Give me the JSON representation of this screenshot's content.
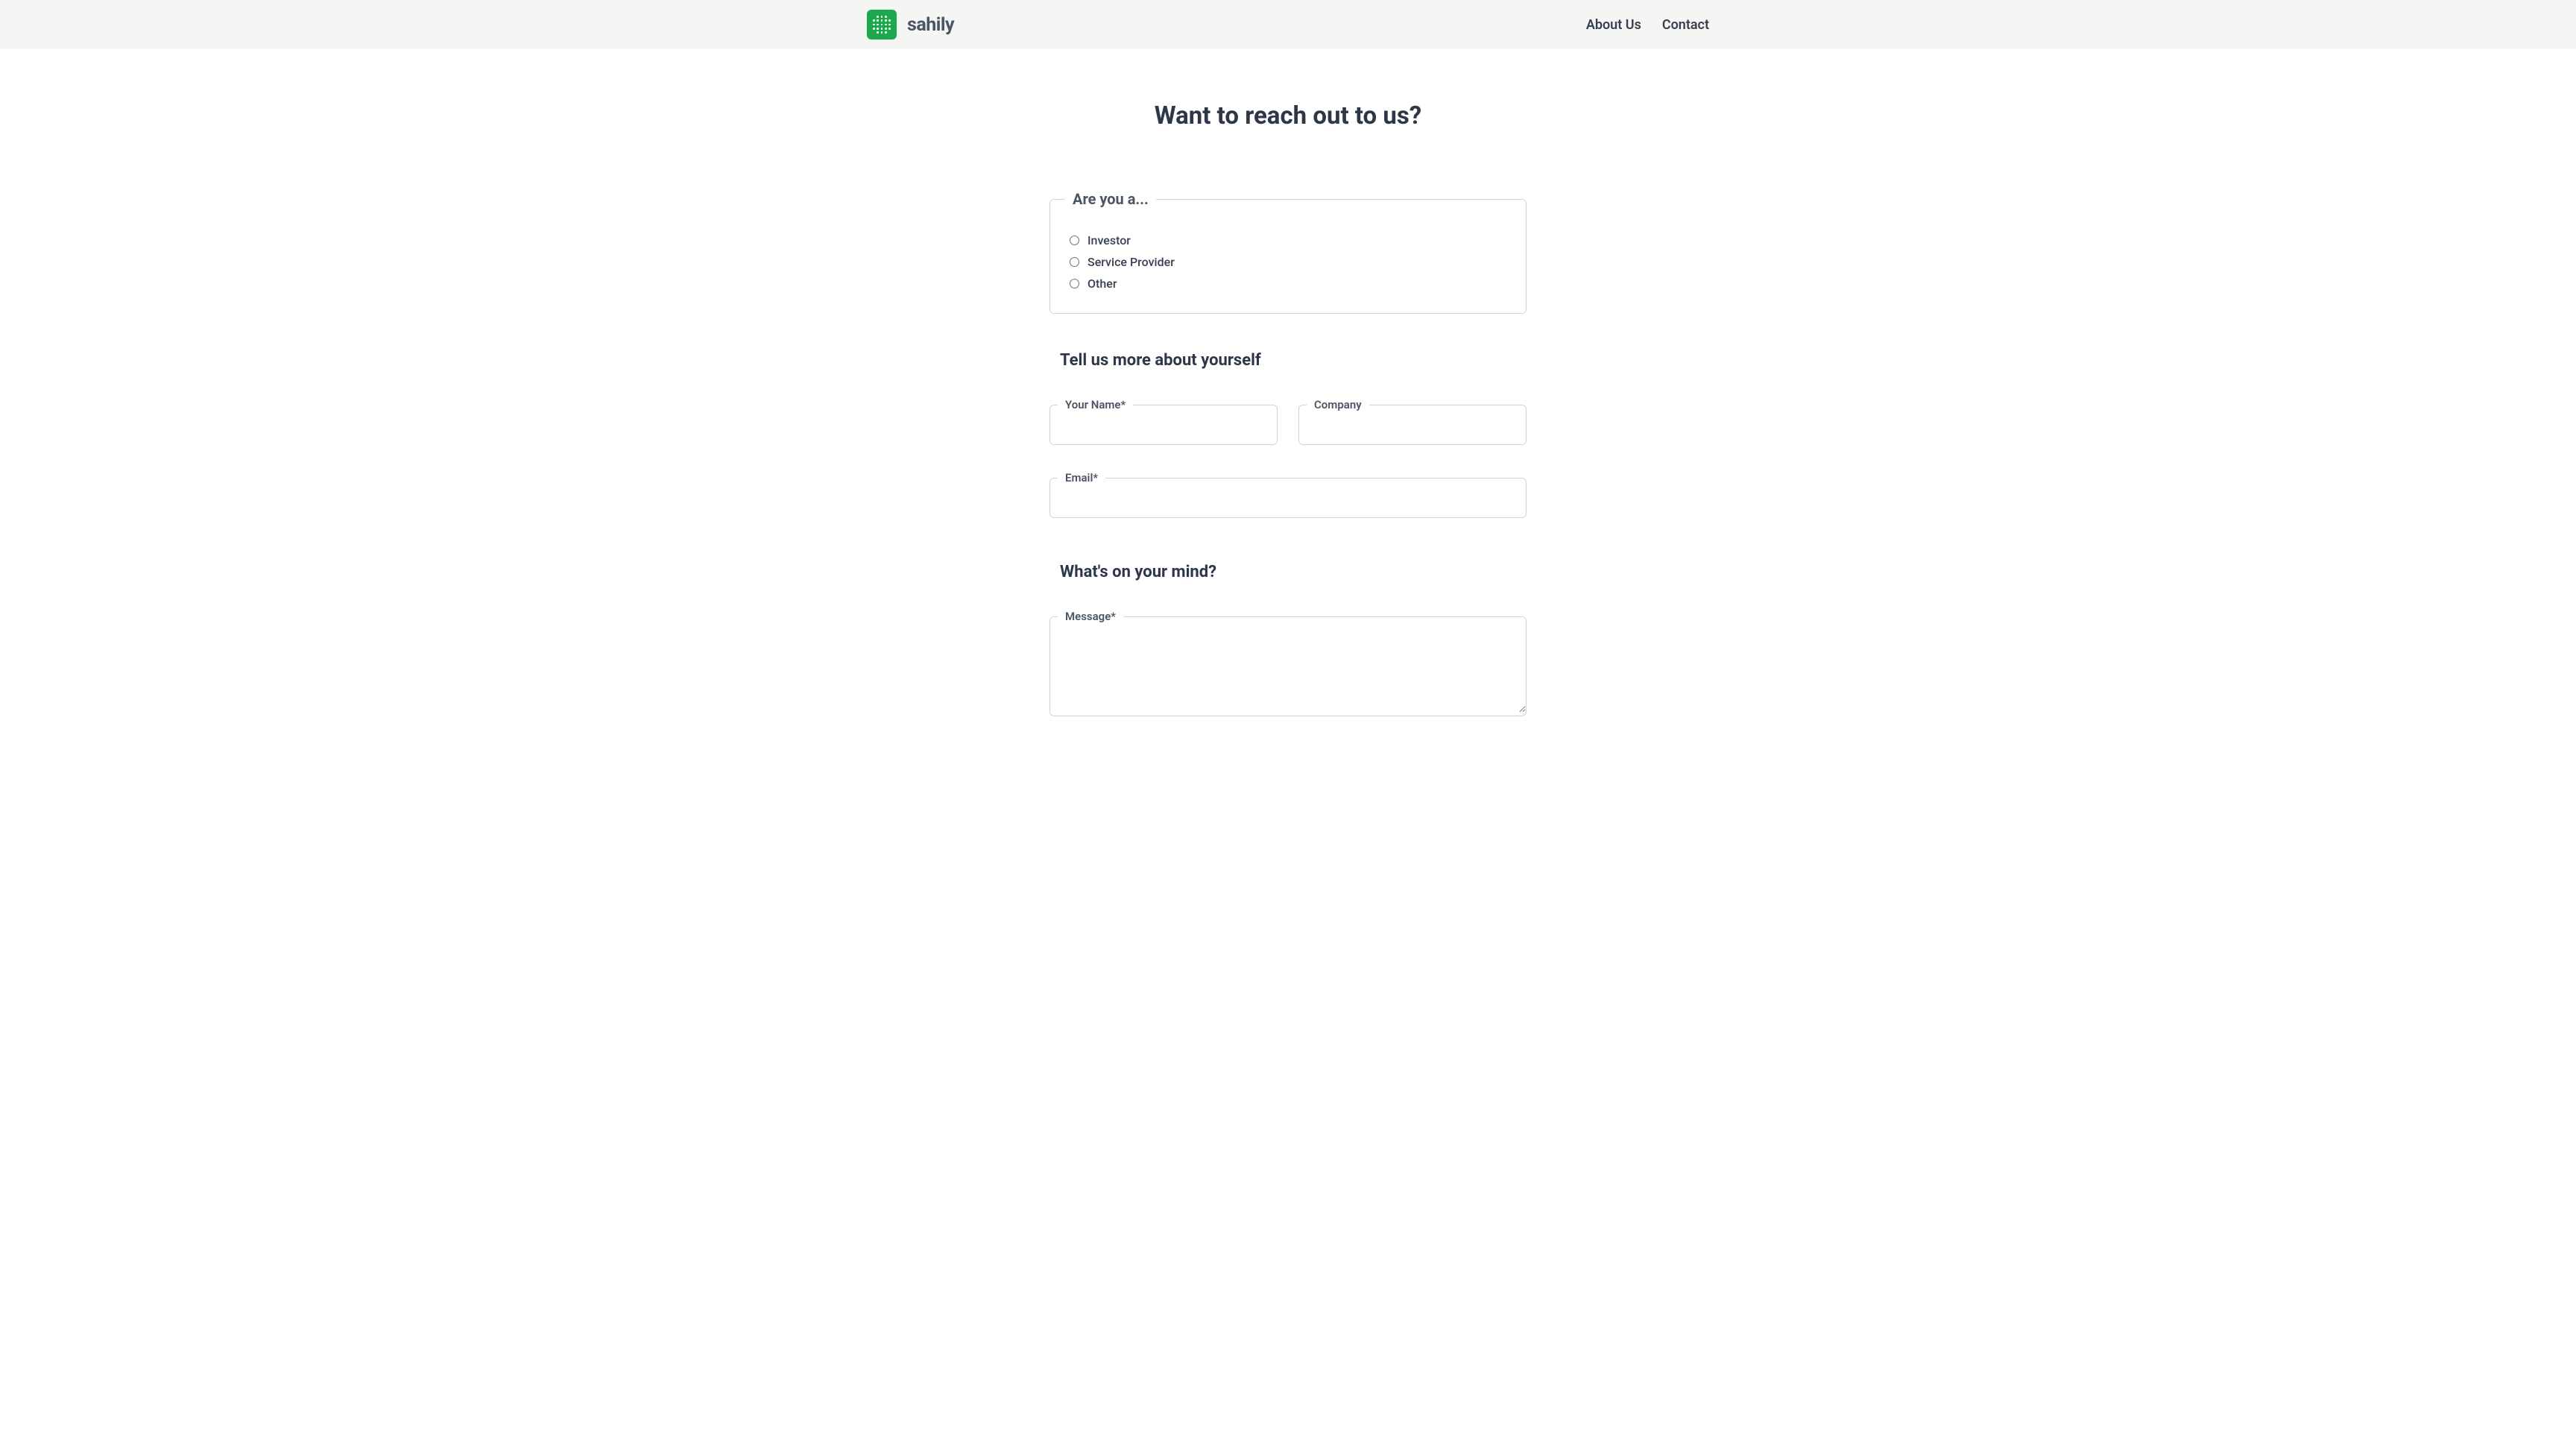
{
  "header": {
    "logo_text": "sahily",
    "nav": {
      "about_us": "About Us",
      "contact": "Contact"
    }
  },
  "page": {
    "title": "Want to reach out to us?"
  },
  "form": {
    "user_type": {
      "legend": "Are you a...",
      "options": [
        "Investor",
        "Service Provider",
        "Other"
      ]
    },
    "about_section": {
      "heading": "Tell us more about yourself",
      "name_label": "Your Name*",
      "company_label": "Company",
      "email_label": "Email*"
    },
    "message_section": {
      "heading": "What's on your mind?",
      "message_label": "Message*"
    }
  }
}
